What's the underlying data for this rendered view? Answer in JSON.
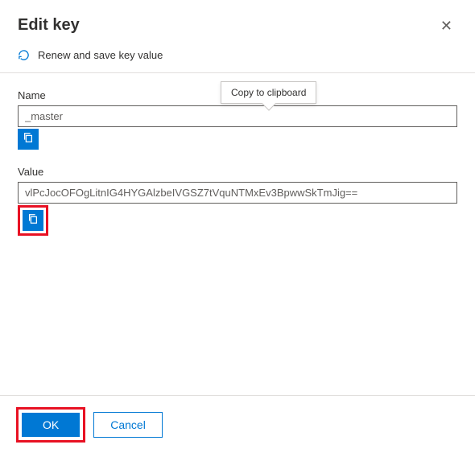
{
  "dialog": {
    "title": "Edit key",
    "renew_label": "Renew and save key value"
  },
  "fields": {
    "name": {
      "label": "Name",
      "value": "_master"
    },
    "value": {
      "label": "Value",
      "value": "vlPcJocOFOgLitnIG4HYGAlzbeIVGSZ7tVquNTMxEv3BpwwSkTmJig=="
    }
  },
  "tooltip": {
    "copy": "Copy to clipboard"
  },
  "buttons": {
    "ok": "OK",
    "cancel": "Cancel"
  }
}
